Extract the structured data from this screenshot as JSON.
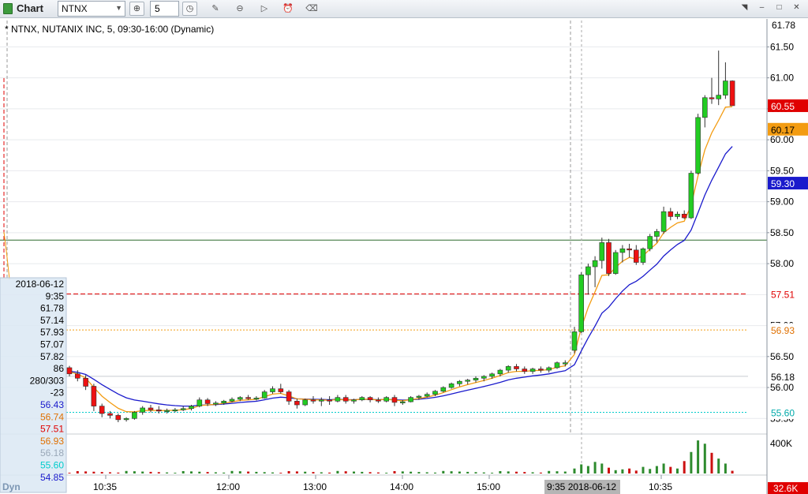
{
  "toolbar": {
    "title": "Chart",
    "symbol": "NTNX",
    "interval": "5",
    "icons": [
      "link-icon",
      "clock-icon",
      "pencil-icon",
      "minus-circle-icon",
      "play-circle-icon",
      "alarm-icon",
      "eraser-icon"
    ]
  },
  "legend": {
    "text": "* NTNX, NUTANIX INC, 5, 09:30-16:00 (Dynamic)"
  },
  "price_axis": {
    "ticks": [
      "61.50",
      "61.00",
      "60.50",
      "60.00",
      "59.50",
      "59.00",
      "58.50",
      "58.00",
      "57.50",
      "57.00",
      "56.50",
      "56.00",
      "55.50"
    ],
    "top_label": "61.78",
    "badges": [
      {
        "value": "60.55",
        "color": "#e00000",
        "text_color": "#ffffff"
      },
      {
        "value": "60.17",
        "color": "#f39c12",
        "text_color": "#000000"
      },
      {
        "value": "59.30",
        "color": "#1a1acc",
        "text_color": "#ffffff"
      },
      {
        "value": "57.51",
        "color": "#ffffff",
        "text_color": "#e00000"
      },
      {
        "value": "56.93",
        "color": "#ffffff",
        "text_color": "#e07000"
      },
      {
        "value": "56.18",
        "color": "#ffffff",
        "text_color": "#000000"
      },
      {
        "value": "55.60",
        "color": "#ffffff",
        "text_color": "#00aaaa"
      }
    ]
  },
  "volume_axis": {
    "top_label": "400K",
    "badge": "32.6K"
  },
  "time_axis": {
    "ticks": [
      "10:35",
      "12:00",
      "13:00",
      "14:00",
      "15:00",
      "10:35"
    ],
    "current": "9:35 2018-06-12"
  },
  "cursor_panel": {
    "rows": [
      {
        "text": "2018-06-12",
        "color": "#000000"
      },
      {
        "text": "9:35",
        "color": "#000000"
      },
      {
        "text": "61.78",
        "color": "#000000"
      },
      {
        "text": "57.14",
        "color": "#000000"
      },
      {
        "text": "57.93",
        "color": "#000000"
      },
      {
        "text": "57.07",
        "color": "#000000"
      },
      {
        "text": "57.82",
        "color": "#000000"
      },
      {
        "text": "86",
        "color": "#000000"
      },
      {
        "text": "280/303",
        "color": "#000000"
      },
      {
        "text": "-23",
        "color": "#000000"
      },
      {
        "text": "56.43",
        "color": "#1a1acc"
      },
      {
        "text": "56.74",
        "color": "#e07000"
      },
      {
        "text": "57.51",
        "color": "#e00000"
      },
      {
        "text": "56.93",
        "color": "#e07000"
      },
      {
        "text": "56.18",
        "color": "#9aa8b8"
      },
      {
        "text": "55.60",
        "color": "#00cccc"
      },
      {
        "text": "54.85",
        "color": "#1a1acc"
      }
    ],
    "footer": "Dyn"
  },
  "chart_data": {
    "type": "candlestick",
    "colors": {
      "up": "#22cc22",
      "down": "#ee1111",
      "ema_fast": "#f39c12",
      "ema_slow": "#1a1acc"
    },
    "candles": [
      [
        56.32,
        56.35,
        56.18,
        56.22
      ],
      [
        56.22,
        56.28,
        56.1,
        56.15
      ],
      [
        56.15,
        56.2,
        55.96,
        56.02
      ],
      [
        56.02,
        56.06,
        55.62,
        55.7
      ],
      [
        55.7,
        55.74,
        55.52,
        55.58
      ],
      [
        55.58,
        55.62,
        55.5,
        55.55
      ],
      [
        55.55,
        55.58,
        55.44,
        55.48
      ],
      [
        55.48,
        55.52,
        55.45,
        55.5
      ],
      [
        55.5,
        55.62,
        55.48,
        55.6
      ],
      [
        55.6,
        55.7,
        55.56,
        55.67
      ],
      [
        55.67,
        55.72,
        55.6,
        55.64
      ],
      [
        55.64,
        55.7,
        55.58,
        55.62
      ],
      [
        55.62,
        55.66,
        55.58,
        55.63
      ],
      [
        55.63,
        55.67,
        55.6,
        55.64
      ],
      [
        55.64,
        55.7,
        55.62,
        55.66
      ],
      [
        55.66,
        55.72,
        55.63,
        55.7
      ],
      [
        55.7,
        55.84,
        55.68,
        55.8
      ],
      [
        55.8,
        55.83,
        55.7,
        55.74
      ],
      [
        55.74,
        55.78,
        55.7,
        55.75
      ],
      [
        55.75,
        55.8,
        55.72,
        55.78
      ],
      [
        55.78,
        55.84,
        55.76,
        55.81
      ],
      [
        55.81,
        55.86,
        55.78,
        55.84
      ],
      [
        55.84,
        55.88,
        55.8,
        55.82
      ],
      [
        55.82,
        55.86,
        55.79,
        55.83
      ],
      [
        55.83,
        55.96,
        55.82,
        55.93
      ],
      [
        55.93,
        56.02,
        55.9,
        55.98
      ],
      [
        55.98,
        56.06,
        55.9,
        55.93
      ],
      [
        55.93,
        55.96,
        55.72,
        55.78
      ],
      [
        55.78,
        55.82,
        55.66,
        55.72
      ],
      [
        55.72,
        55.82,
        55.7,
        55.8
      ],
      [
        55.8,
        55.86,
        55.74,
        55.78
      ],
      [
        55.78,
        55.84,
        55.7,
        55.8
      ],
      [
        55.8,
        55.86,
        55.72,
        55.78
      ],
      [
        55.78,
        55.88,
        55.76,
        55.84
      ],
      [
        55.84,
        55.88,
        55.74,
        55.78
      ],
      [
        55.78,
        55.82,
        55.74,
        55.8
      ],
      [
        55.8,
        55.86,
        55.78,
        55.84
      ],
      [
        55.84,
        55.86,
        55.76,
        55.8
      ],
      [
        55.8,
        55.84,
        55.75,
        55.78
      ],
      [
        55.78,
        55.86,
        55.76,
        55.84
      ],
      [
        55.84,
        55.88,
        55.7,
        55.76
      ],
      [
        55.76,
        55.8,
        55.72,
        55.77
      ],
      [
        55.77,
        55.86,
        55.76,
        55.84
      ],
      [
        55.84,
        55.88,
        55.8,
        55.86
      ],
      [
        55.86,
        55.92,
        55.84,
        55.89
      ],
      [
        55.89,
        55.96,
        55.86,
        55.94
      ],
      [
        55.94,
        56.02,
        55.92,
        56.0
      ],
      [
        56.0,
        56.08,
        55.98,
        56.06
      ],
      [
        56.06,
        56.12,
        56.02,
        56.1
      ],
      [
        56.1,
        56.14,
        56.05,
        56.12
      ],
      [
        56.12,
        56.18,
        56.08,
        56.15
      ],
      [
        56.15,
        56.2,
        56.1,
        56.18
      ],
      [
        56.18,
        56.24,
        56.14,
        56.22
      ],
      [
        56.22,
        56.3,
        56.18,
        56.28
      ],
      [
        56.28,
        56.36,
        56.24,
        56.34
      ],
      [
        56.34,
        56.38,
        56.26,
        56.3
      ],
      [
        56.3,
        56.34,
        56.22,
        56.26
      ],
      [
        56.26,
        56.32,
        56.22,
        56.3
      ],
      [
        56.3,
        56.34,
        56.24,
        56.28
      ],
      [
        56.28,
        56.34,
        56.24,
        56.32
      ],
      [
        56.32,
        56.42,
        56.3,
        56.4
      ],
      [
        56.4,
        56.44,
        56.34,
        56.4
      ],
      [
        56.6,
        56.98,
        56.55,
        56.9
      ],
      [
        56.9,
        57.86,
        56.88,
        57.82
      ],
      [
        57.82,
        58.0,
        57.5,
        57.95
      ],
      [
        57.95,
        58.12,
        57.62,
        58.05
      ],
      [
        58.05,
        58.42,
        57.92,
        58.34
      ],
      [
        58.34,
        58.4,
        57.8,
        57.84
      ],
      [
        57.84,
        58.22,
        57.82,
        58.18
      ],
      [
        58.18,
        58.3,
        58.02,
        58.24
      ],
      [
        58.24,
        58.32,
        58.1,
        58.22
      ],
      [
        58.22,
        58.3,
        57.98,
        58.02
      ],
      [
        58.02,
        58.26,
        57.98,
        58.24
      ],
      [
        58.24,
        58.48,
        58.2,
        58.44
      ],
      [
        58.44,
        58.56,
        58.34,
        58.52
      ],
      [
        58.52,
        58.92,
        58.48,
        58.84
      ],
      [
        58.84,
        58.9,
        58.7,
        58.76
      ],
      [
        58.76,
        58.84,
        58.72,
        58.8
      ],
      [
        58.8,
        58.86,
        58.72,
        58.74
      ],
      [
        58.74,
        59.5,
        58.72,
        59.46
      ],
      [
        59.46,
        60.42,
        59.44,
        60.36
      ],
      [
        60.36,
        60.72,
        60.2,
        60.68
      ],
      [
        60.68,
        61.0,
        60.58,
        60.66
      ],
      [
        60.66,
        61.44,
        60.56,
        60.72
      ],
      [
        60.72,
        61.25,
        60.66,
        60.95
      ],
      [
        60.95,
        60.96,
        60.55,
        60.55
      ]
    ],
    "ema_fast": [
      56.26,
      56.18,
      56.06,
      55.92,
      55.8,
      55.7,
      55.64,
      55.6,
      55.59,
      55.6
    ],
    "ema_slow": [
      56.18,
      56.1,
      56.0,
      55.9,
      55.82,
      55.76,
      55.72,
      55.7,
      55.69,
      55.69
    ],
    "horizontal_lines": [
      {
        "value": 58.38,
        "color": "#2d6a2d",
        "style": "solid"
      },
      {
        "value": 57.51,
        "color": "#e00000",
        "style": "dashed"
      },
      {
        "value": 56.93,
        "color": "#f39c12",
        "style": "dotted"
      },
      {
        "value": 56.18,
        "color": "#c8ccd2",
        "style": "solid"
      },
      {
        "value": 55.6,
        "color": "#00cccc",
        "style": "dotted"
      }
    ],
    "ylim": [
      55.3,
      61.9
    ],
    "volume_ylim": [
      0,
      420000
    ],
    "volume_max_label": "400K"
  }
}
